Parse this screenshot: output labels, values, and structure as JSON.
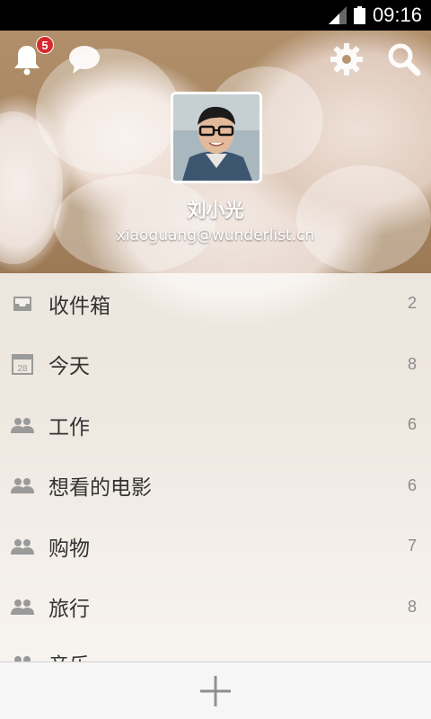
{
  "status_bar": {
    "time": "09:16"
  },
  "header": {
    "notification_count": "5",
    "icons": [
      "bell-icon",
      "chat-icon",
      "gear-icon",
      "search-icon"
    ]
  },
  "profile": {
    "name": "刘小光",
    "email": "xiaoguang@wunderlist.cn"
  },
  "lists": [
    {
      "label": "收件箱",
      "count": "2",
      "icon": "inbox-icon"
    },
    {
      "label": "今天",
      "count": "8",
      "icon": "calendar-icon"
    },
    {
      "label": "工作",
      "count": "6",
      "icon": "shared-users-icon"
    },
    {
      "label": "想看的电影",
      "count": "6",
      "icon": "shared-users-icon"
    },
    {
      "label": "购物",
      "count": "7",
      "icon": "shared-users-icon"
    },
    {
      "label": "旅行",
      "count": "8",
      "icon": "shared-users-icon"
    },
    {
      "label": "音乐",
      "count": "",
      "icon": "shared-users-icon"
    }
  ],
  "calendar_icon_day": "28",
  "colors": {
    "badge": "#d8282d",
    "icon_gray": "#9a9a9a",
    "text": "#333333"
  }
}
